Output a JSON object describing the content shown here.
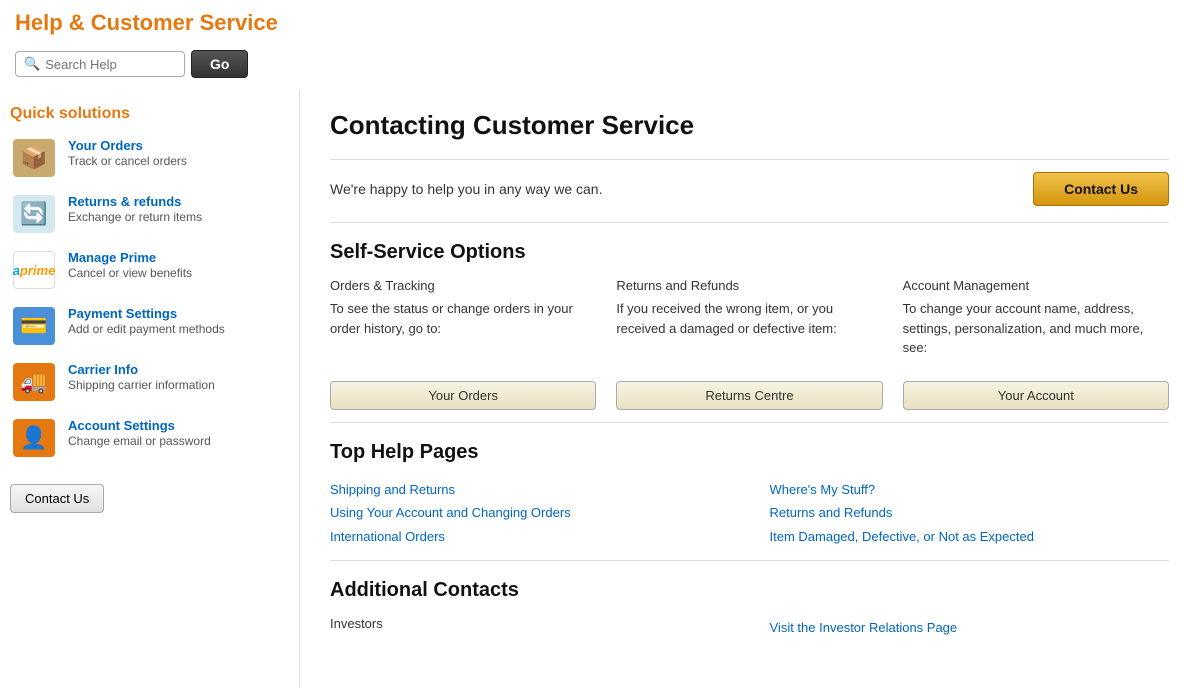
{
  "page": {
    "title": "Help & Customer Service",
    "search": {
      "placeholder": "Search Help",
      "go_label": "Go"
    },
    "sidebar": {
      "section_title": "Quick solutions",
      "items": [
        {
          "label": "Your Orders",
          "desc": "Track or cancel orders",
          "icon_type": "orders"
        },
        {
          "label": "Returns & refunds",
          "desc": "Exchange or return items",
          "icon_type": "returns"
        },
        {
          "label": "Manage Prime",
          "desc": "Cancel or view benefits",
          "icon_type": "prime"
        },
        {
          "label": "Payment Settings",
          "desc": "Add or edit payment methods",
          "icon_type": "payment"
        },
        {
          "label": "Carrier Info",
          "desc": "Shipping carrier information",
          "icon_type": "carrier"
        },
        {
          "label": "Account Settings",
          "desc": "Change email or password",
          "icon_type": "account"
        }
      ],
      "contact_btn_label": "Contact Us"
    },
    "main": {
      "title": "Contacting Customer Service",
      "intro": "We're happy to help you in any way we can.",
      "contact_us_label": "Contact Us",
      "self_service_title": "Self-Service Options",
      "columns": [
        {
          "col_title": "Orders & Tracking",
          "col_desc": "To see the status or change orders in your order history, go to:",
          "btn_label": "Your Orders"
        },
        {
          "col_title": "Returns and Refunds",
          "col_desc": "If you received the wrong item, or you received a damaged or defective item:",
          "btn_label": "Returns Centre"
        },
        {
          "col_title": "Account Management",
          "col_desc": "To change your account name, address, settings, personalization, and much more, see:",
          "btn_label": "Your Account"
        }
      ],
      "top_help_title": "Top Help Pages",
      "top_help_left": [
        "Shipping and Returns",
        "Using Your Account and Changing Orders",
        "International Orders"
      ],
      "top_help_right": [
        "Where's My Stuff?",
        "Returns and Refunds",
        "Item Damaged, Defective, or Not as Expected"
      ],
      "additional_contacts_title": "Additional Contacts",
      "additional_contacts": [
        {
          "label": "Investors",
          "link_label": "Visit the Investor Relations Page"
        }
      ]
    }
  }
}
